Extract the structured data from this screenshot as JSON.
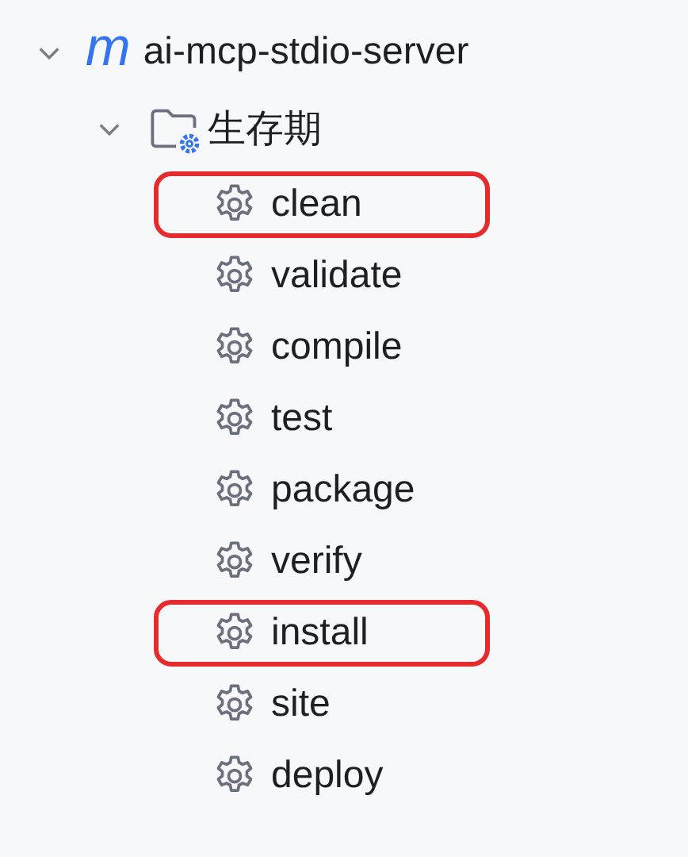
{
  "tree": {
    "icon": "m",
    "label": "ai-mcp-stdio-server",
    "expanded": true,
    "children": [
      {
        "label": "生存期",
        "expanded": true,
        "children": [
          {
            "label": "clean",
            "highlighted": true
          },
          {
            "label": "validate",
            "highlighted": false
          },
          {
            "label": "compile",
            "highlighted": false
          },
          {
            "label": "test",
            "highlighted": false
          },
          {
            "label": "package",
            "highlighted": false
          },
          {
            "label": "verify",
            "highlighted": false
          },
          {
            "label": "install",
            "highlighted": true
          },
          {
            "label": "site",
            "highlighted": false
          },
          {
            "label": "deploy",
            "highlighted": false
          }
        ]
      }
    ]
  }
}
